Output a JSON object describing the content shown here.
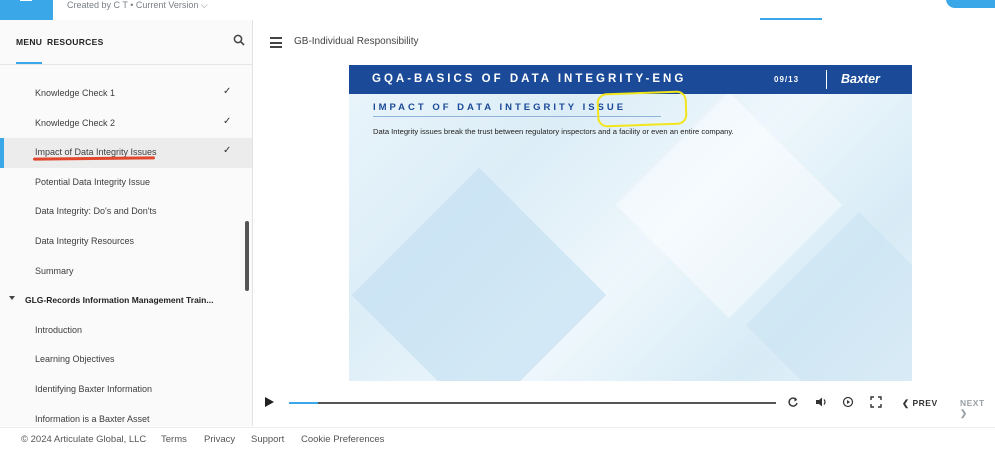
{
  "top": {
    "meta": "Created by C T  •  Current Version ⌵"
  },
  "sidebar": {
    "tabs": [
      "MENU",
      "RESOURCES"
    ],
    "items": [
      {
        "label": "Knowledge Check 1",
        "check": "✓"
      },
      {
        "label": "Knowledge Check 2",
        "check": "✓"
      },
      {
        "label": "Impact of Data Integrity Issues",
        "check": "✓"
      },
      {
        "label": "Potential Data Integrity Issue",
        "check": ""
      },
      {
        "label": "Data Integrity: Do's and Don'ts",
        "check": ""
      },
      {
        "label": "Data Integrity Resources",
        "check": ""
      },
      {
        "label": "Summary",
        "check": ""
      },
      {
        "label": "GLG-Records Information Management Train...",
        "check": ""
      },
      {
        "label": "Introduction",
        "check": ""
      },
      {
        "label": "Learning Objectives",
        "check": ""
      },
      {
        "label": "Identifying Baxter Information",
        "check": ""
      },
      {
        "label": "Information is a Baxter Asset",
        "check": ""
      }
    ]
  },
  "main": {
    "course_title": "GB-Individual Responsibility"
  },
  "slide": {
    "title": "GQA-BASICS OF DATA INTEGRITY-ENG",
    "page": "09/13",
    "brand": "Baxter",
    "subtitle": "IMPACT OF DATA INTEGRITY ISSUE",
    "body": "Data Integrity issues break the trust between regulatory inspectors and a facility or even an entire company."
  },
  "player": {
    "progress": 0.06,
    "prev": "PREV",
    "next": "NEXT"
  },
  "footer": {
    "copyright": "© 2024 Articulate Global, LLC",
    "links": [
      "Terms",
      "Privacy",
      "Support",
      "Cookie Preferences"
    ]
  },
  "colors": {
    "accent": "#3aa8e8",
    "slide_header": "#1b4a98",
    "annotation_red": "#e0472d",
    "annotation_yellow": "#f2e61b"
  }
}
